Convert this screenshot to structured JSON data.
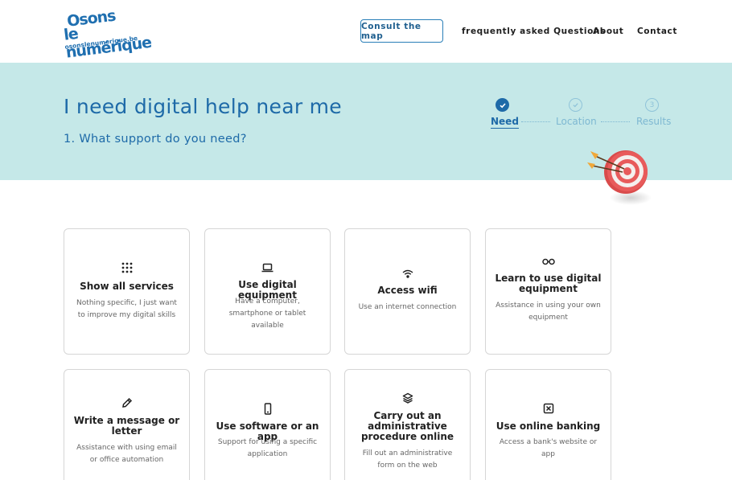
{
  "header": {
    "logo": {
      "line1": "Osons",
      "line2": "le numérique",
      "line3": "osonslenumerique.be"
    },
    "consult_map": "Consult the map",
    "faq": "frequently asked Questions",
    "about": "About",
    "contact": "Contact"
  },
  "hero": {
    "title": "I need digital help near me",
    "subtitle": "1. What support do you need?",
    "steps": [
      {
        "label": "Need",
        "state": "done"
      },
      {
        "label": "Location",
        "state": "pending"
      },
      {
        "label": "Results",
        "number": "3",
        "state": "pending"
      }
    ]
  },
  "colors": {
    "primary": "#1e6aa8",
    "hero_bg": "#c5e8e8",
    "step_muted": "#7eb8d2"
  },
  "cards": [
    {
      "icon": "grid-icon",
      "title": "Show all services",
      "desc": "Nothing specific, I just want to improve my digital skills"
    },
    {
      "icon": "laptop-icon",
      "title": "Use digital equipment",
      "desc": "Have a computer, smartphone or tablet available"
    },
    {
      "icon": "wifi-icon",
      "title": "Access wifi",
      "desc": "Use an internet connection"
    },
    {
      "icon": "glasses-icon",
      "title": "Learn to use digital equipment",
      "desc": "Assistance in using your own equipment"
    },
    {
      "icon": "pencil-icon",
      "title": "Write a message or letter",
      "desc": "Assistance with using email or office automation"
    },
    {
      "icon": "smartphone-icon",
      "title": "Use software or an app",
      "desc": "Support for using a specific application"
    },
    {
      "icon": "layers-icon",
      "title": "Carry out an administrative procedure online",
      "desc": "Fill out an administrative form on the web"
    },
    {
      "icon": "bank-card-icon",
      "title": "Use online banking",
      "desc": "Access a bank's website or app"
    }
  ]
}
